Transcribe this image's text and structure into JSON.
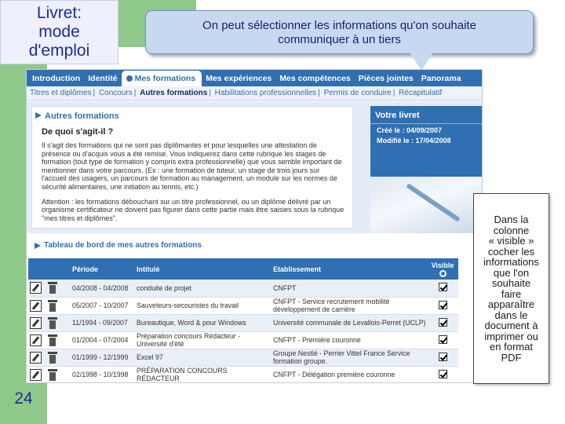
{
  "slide": {
    "title_lines": [
      "Livret:",
      "mode",
      "d'emploi"
    ],
    "page_number": "24",
    "callout_lines": [
      "On peut  sélectionner les informations qu'on souhaite",
      "communiquer à un tiers"
    ],
    "sidenote_lines": [
      "Dans la",
      "colonne",
      "« visible »",
      "cocher les",
      "informations",
      "que l'on",
      "souhaite",
      "faire",
      "apparaître",
      "dans le",
      "document à",
      "imprimer ou",
      "en format",
      "PDF"
    ]
  },
  "nav": {
    "tabs": [
      "Introduction",
      "Identité",
      "Mes formations",
      "Mes expériences",
      "Mes compétences",
      "Pièces jointes",
      "Panorama"
    ],
    "active_tab": "Mes formations"
  },
  "subnav": {
    "items": [
      "Titres et diplômes",
      "Concours",
      "Autres formations",
      "Habilitations professionnelles",
      "Permis de conduire",
      "Récapitulatif"
    ],
    "current": "Autres formations"
  },
  "intro": {
    "section_title": "Autres formations",
    "question": "De quoi s'agit-il ?",
    "paragraph1": "Il s'agit des formations qui ne sont pas diplômantes et pour lesquelles une attestation de présence ou d'acquis vous a été remise. Vous indiquerez dans cette rubrique les stages de formation (tout type de formation y compris extra professionnelle) que vous semble important de mentionner dans votre parcours. (Ex : une formation de tuteur, un stage de trois jours sur l'accueil des usagers, un parcours de formation au management, un module sur les normes de sécurité alimentaires, une initiation au tennis, etc.)",
    "paragraph2": "Attention : les formations débouchant sur un titre professionnel, ou un diplôme délivré par un organisme certificateur ne doivent pas figurer dans cette partie mais être saisies sous la rubrique \"mes titres et diplômes\"."
  },
  "livret": {
    "title": "Votre livret",
    "created": "Créé le : 04/09/2007",
    "modified": "Modifié le : 17/04/2008"
  },
  "table": {
    "section_title": "Tableau de bord de mes autres formations",
    "columns": [
      "Période",
      "Intitulé",
      "Etablissement",
      "Visible"
    ],
    "rows": [
      {
        "period": "04/2008 - 04/2008",
        "title": "conduite de projet",
        "establishment": "CNFPT",
        "visible": true
      },
      {
        "period": "05/2007 - 10/2007",
        "title": "Sauveteurs-secouristes du travail",
        "establishment": "CNFPT - Service recrutement mobilité développement de carrière",
        "visible": true
      },
      {
        "period": "11/1994 - 09/2007",
        "title": "Bureautique, Word & pour Windows",
        "establishment": "Université communale de Levallois-Perret (UCLP)",
        "visible": true
      },
      {
        "period": "01/2004 - 07/2004",
        "title": "Préparation concours Rédacteur - Université d'été",
        "establishment": "CNFPT - Première couronne",
        "visible": true
      },
      {
        "period": "01/1999 - 12/1999",
        "title": "Excel 97",
        "establishment": "Groupe Nestlé - Perrier Vittel France Service formation groupe.",
        "visible": true
      },
      {
        "period": "02/1998 - 10/1998",
        "title": "PRÉPARATION CONCOURS RÉDACTEUR",
        "establishment": "CNFPT - Délégation première couronne",
        "visible": true
      }
    ]
  },
  "colors": {
    "primary_blue": "#2f6fb2",
    "slide_green": "#8fc98a",
    "callout_fill": "#c7d9f1"
  }
}
